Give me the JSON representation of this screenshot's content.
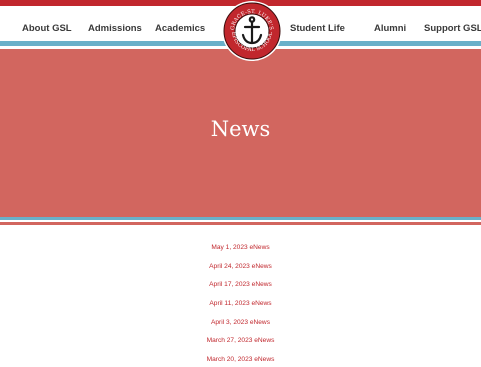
{
  "nav": {
    "left": [
      "About GSL",
      "Admissions",
      "Academics"
    ],
    "right": [
      "Student Life",
      "Alumni",
      "Support GSL"
    ]
  },
  "logo": {
    "top_text": "GRACE-ST. LUKE'S",
    "bottom_text": "EPISCOPAL SCHOOL"
  },
  "hero": {
    "title": "News"
  },
  "news": [
    "May 1, 2023 eNews",
    "April 24, 2023 eNews",
    "April 17, 2023 eNews",
    "April 11, 2023 eNews",
    "April 3, 2023 eNews",
    "March 27, 2023 eNews",
    "March 20, 2023 eNews"
  ],
  "colors": {
    "brand_red": "#c1272d",
    "hero_red": "#d2665f",
    "accent_blue": "#6ab0c9",
    "nav_text": "#3a3a3a"
  }
}
